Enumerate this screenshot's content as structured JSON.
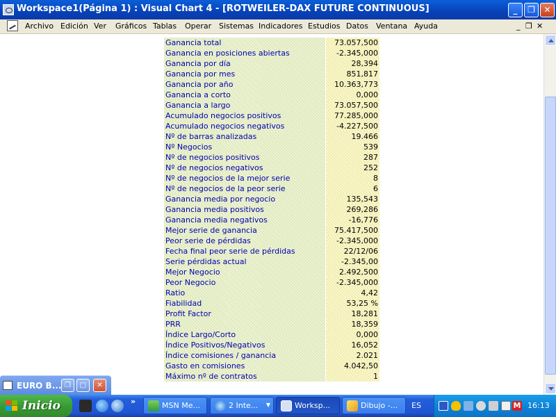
{
  "window": {
    "title": "Workspace1(Página 1) : Visual Chart 4 - [ROTWEILER-DAX FUTURE CONTINUOUS]",
    "min_glyph": "_",
    "max_glyph": "❐",
    "close_glyph": "✕"
  },
  "menubar": {
    "items": [
      "Archivo",
      "Edición",
      "Ver",
      "Gráficos",
      "Tablas",
      "Operar",
      "Sistemas",
      "Indicadores",
      "Estudios",
      "Datos",
      "Ventana",
      "Ayuda"
    ],
    "mdi_min": "_",
    "mdi_restore": "❐",
    "mdi_close": "✕"
  },
  "stats": [
    {
      "label": "Ganancia total",
      "value": "73.057,500"
    },
    {
      "label": "Ganancia en posiciones abiertas",
      "value": "-2.345,000"
    },
    {
      "label": "Ganancia por día",
      "value": "28,394"
    },
    {
      "label": "Ganancia por mes",
      "value": "851,817"
    },
    {
      "label": "Ganancia por año",
      "value": "10.363,773"
    },
    {
      "label": "Ganancia a corto",
      "value": "0,000"
    },
    {
      "label": "Ganancia a largo",
      "value": "73.057,500"
    },
    {
      "label": "Acumulado negocios positivos",
      "value": "77.285,000"
    },
    {
      "label": "Acumulado negocios negativos",
      "value": "-4.227,500"
    },
    {
      "label": "Nº de barras analizadas",
      "value": "19.466"
    },
    {
      "label": "Nº Negocios",
      "value": "539"
    },
    {
      "label": "Nº de negocios positivos",
      "value": "287"
    },
    {
      "label": "Nº de negocios negativos",
      "value": "252"
    },
    {
      "label": "Nº de negocios de la mejor serie",
      "value": "8"
    },
    {
      "label": "Nº de negocios de la peor serie",
      "value": "6"
    },
    {
      "label": "Ganancia media por negocio",
      "value": "135,543"
    },
    {
      "label": "Ganancia media positivos",
      "value": "269,286"
    },
    {
      "label": "Ganancia media negativos",
      "value": "-16,776"
    },
    {
      "label": "Mejor serie de ganancia",
      "value": "75.417,500"
    },
    {
      "label": "Peor serie de pérdidas",
      "value": "-2.345,000"
    },
    {
      "label": "Fecha final peor serie de pérdidas",
      "value": "22/12/06"
    },
    {
      "label": "Serie pérdidas actual",
      "value": "-2.345,00"
    },
    {
      "label": "Mejor Negocio",
      "value": "2.492,500"
    },
    {
      "label": "Peor Negocio",
      "value": "-2.345,000"
    },
    {
      "label": "Ratio",
      "value": "4,42"
    },
    {
      "label": "Fiabilidad",
      "value": "53,25 %"
    },
    {
      "label": "Profit Factor",
      "value": "18,281"
    },
    {
      "label": "PRR",
      "value": "18,359"
    },
    {
      "label": "Índice Largo/Corto",
      "value": "0,000"
    },
    {
      "label": "Índice Positivos/Negativos",
      "value": "16,052"
    },
    {
      "label": "Índice comisiones / ganancia",
      "value": "2.021"
    },
    {
      "label": "Gasto en comisiones",
      "value": "4.042,50"
    },
    {
      "label": "Máximo nº de contratos",
      "value": "1"
    }
  ],
  "minimized_window": {
    "title": "EURO B..."
  },
  "taskbar": {
    "start_label": "Inicio",
    "chevron": "»",
    "tasks": [
      {
        "label": "MSN Me...",
        "icon": "msn-icon"
      },
      {
        "label": "2 Inte...",
        "icon": "ie-icon"
      },
      {
        "label": "Worksp...",
        "icon": "visual-chart-icon"
      },
      {
        "label": "Dibujo -...",
        "icon": "paint-icon"
      }
    ],
    "language": "ES",
    "clock": "16:13"
  },
  "colors": {
    "label_text": "#0000b0",
    "label_bg": "#edf3d4",
    "value_bg": "#fbf8c9",
    "titlebar": "#0a5fd8",
    "taskbar": "#245edb",
    "start": "#3a9b35"
  }
}
